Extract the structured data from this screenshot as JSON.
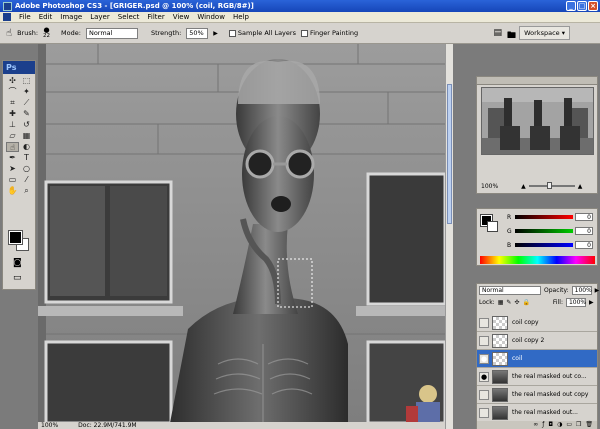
{
  "window": {
    "title": "Adobe Photoshop CS3 - [GRIGER.psd @ 100% (coil, RGB/8#)]"
  },
  "menu": [
    "File",
    "Edit",
    "Image",
    "Layer",
    "Select",
    "Filter",
    "View",
    "Window",
    "Help"
  ],
  "options": {
    "brush_label": "Brush:",
    "brush_size": "22",
    "mode_label": "Mode:",
    "mode_value": "Normal",
    "strength_label": "Strength:",
    "strength_value": "50%",
    "sample_all_layers": "Sample All Layers",
    "finger_painting": "Finger Painting",
    "workspace": "Workspace"
  },
  "toolbox": {
    "logo": "Ps"
  },
  "status": {
    "zoom": "100%",
    "doc": "Doc: 22.9M/741.9M"
  },
  "navigator": {
    "zoom": "100%"
  },
  "color": {
    "r_label": "R",
    "r_value": "0",
    "g_label": "G",
    "g_value": "0",
    "b_label": "B",
    "b_value": "0"
  },
  "layers": {
    "blend_mode": "Normal",
    "opacity_label": "Opacity:",
    "opacity_value": "100%",
    "lock_label": "Lock:",
    "fill_label": "Fill:",
    "fill_value": "100%",
    "items": [
      {
        "name": "coil copy",
        "visible": false
      },
      {
        "name": "coil copy 2",
        "visible": false
      },
      {
        "name": "coil",
        "visible": true,
        "selected": true
      },
      {
        "name": "the real masked out co...",
        "visible": true
      },
      {
        "name": "the real masked out copy",
        "visible": false
      },
      {
        "name": "the real masked out...",
        "visible": false
      }
    ]
  }
}
